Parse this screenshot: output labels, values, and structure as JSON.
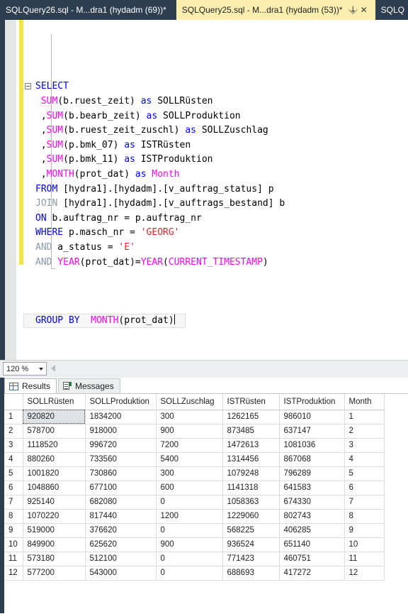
{
  "tabs": [
    {
      "label": "SQLQuery26.sql - M...dra1 (hydadm (69))*",
      "active": false,
      "pin": "",
      "close": ""
    },
    {
      "label": "SQLQuery25.sql - M...dra1 (hydadm (53))*",
      "active": true,
      "pin": "⇲",
      "close": "✕"
    },
    {
      "label": "SQLQ",
      "active": false,
      "pin": "",
      "close": ""
    }
  ],
  "editor": {
    "zoom_level": "120 %",
    "lines": [
      {
        "n": 1,
        "collapse": true,
        "indent": 0,
        "tokens": [
          {
            "t": "SELECT",
            "c": "kw"
          }
        ]
      },
      {
        "n": 2,
        "collapse": false,
        "indent": 1,
        "tokens": [
          {
            "t": "SUM",
            "c": "fn"
          },
          {
            "t": "(b.ruest_zeit)",
            "c": "id"
          },
          {
            "t": " ",
            "c": "id"
          },
          {
            "t": "as",
            "c": "kw"
          },
          {
            "t": " SOLLRüsten",
            "c": "id"
          }
        ]
      },
      {
        "n": 3,
        "collapse": false,
        "indent": 1,
        "tokens": [
          {
            "t": ",",
            "c": "id"
          },
          {
            "t": "SUM",
            "c": "fn"
          },
          {
            "t": "(b.bearb_zeit)",
            "c": "id"
          },
          {
            "t": " ",
            "c": "id"
          },
          {
            "t": "as",
            "c": "kw"
          },
          {
            "t": " SOLLProduktion",
            "c": "id"
          }
        ]
      },
      {
        "n": 4,
        "collapse": false,
        "indent": 1,
        "tokens": [
          {
            "t": ",",
            "c": "id"
          },
          {
            "t": "SUM",
            "c": "fn"
          },
          {
            "t": "(b.ruest_zeit_zuschl)",
            "c": "id"
          },
          {
            "t": " ",
            "c": "id"
          },
          {
            "t": "as",
            "c": "kw"
          },
          {
            "t": " SOLLZuschlag",
            "c": "id"
          }
        ]
      },
      {
        "n": 5,
        "collapse": false,
        "indent": 1,
        "tokens": [
          {
            "t": ",",
            "c": "id"
          },
          {
            "t": "SUM",
            "c": "fn"
          },
          {
            "t": "(p.bmk_07)",
            "c": "id"
          },
          {
            "t": " ",
            "c": "id"
          },
          {
            "t": "as",
            "c": "kw"
          },
          {
            "t": " ISTRüsten",
            "c": "id"
          }
        ]
      },
      {
        "n": 6,
        "collapse": false,
        "indent": 1,
        "tokens": [
          {
            "t": ",",
            "c": "id"
          },
          {
            "t": "SUM",
            "c": "fn"
          },
          {
            "t": "(p.bmk_11)",
            "c": "id"
          },
          {
            "t": " ",
            "c": "id"
          },
          {
            "t": "as",
            "c": "kw"
          },
          {
            "t": " ISTProduktion",
            "c": "id"
          }
        ]
      },
      {
        "n": 7,
        "collapse": false,
        "indent": 1,
        "tokens": [
          {
            "t": ",",
            "c": "id"
          },
          {
            "t": "MONTH",
            "c": "fn"
          },
          {
            "t": "(prot_dat)",
            "c": "id"
          },
          {
            "t": " ",
            "c": "id"
          },
          {
            "t": "as",
            "c": "kw"
          },
          {
            "t": " ",
            "c": "id"
          },
          {
            "t": "Month",
            "c": "fn"
          }
        ]
      },
      {
        "n": 8,
        "collapse": false,
        "indent": 0,
        "tokens": [
          {
            "t": "FROM",
            "c": "kw"
          },
          {
            "t": " [hydra1].[hydadm].[v_auftrag_status] p",
            "c": "id"
          }
        ]
      },
      {
        "n": 9,
        "collapse": false,
        "indent": 0,
        "tokens": [
          {
            "t": "JOIN",
            "c": "kwg"
          },
          {
            "t": " [hydra1].[hydadm].[v_auftrags_bestand] b",
            "c": "id"
          }
        ]
      },
      {
        "n": 10,
        "collapse": false,
        "indent": 0,
        "tokens": [
          {
            "t": "ON",
            "c": "kw"
          },
          {
            "t": " b.auftrag_nr = p.auftrag_nr",
            "c": "id"
          }
        ]
      },
      {
        "n": 11,
        "collapse": false,
        "indent": 0,
        "tokens": [
          {
            "t": "WHERE",
            "c": "kw"
          },
          {
            "t": " p.masch_nr = ",
            "c": "id"
          },
          {
            "t": "'GEORG'",
            "c": "str"
          }
        ]
      },
      {
        "n": 12,
        "collapse": false,
        "indent": 0,
        "tokens": [
          {
            "t": "AND",
            "c": "kwg"
          },
          {
            "t": " a_status = ",
            "c": "id"
          },
          {
            "t": "'E'",
            "c": "str"
          }
        ]
      },
      {
        "n": 13,
        "collapse": false,
        "indent": 0,
        "tokens": [
          {
            "t": "AND",
            "c": "kwg"
          },
          {
            "t": " ",
            "c": "id"
          },
          {
            "t": "YEAR",
            "c": "fn"
          },
          {
            "t": "(prot_dat)=",
            "c": "id"
          },
          {
            "t": "YEAR",
            "c": "fn"
          },
          {
            "t": "(",
            "c": "id"
          },
          {
            "t": "CURRENT_TIMESTAMP",
            "c": "fn"
          },
          {
            "t": ")",
            "c": "id"
          }
        ]
      },
      {
        "n": 14,
        "collapse": false,
        "indent": 0,
        "tokens": []
      },
      {
        "n": 15,
        "collapse": false,
        "indent": 0,
        "tokens": []
      },
      {
        "n": 16,
        "collapse": false,
        "indent": 0,
        "tokens": []
      },
      {
        "n": 17,
        "collapse": false,
        "indent": 0,
        "current": true,
        "tokens": [
          {
            "t": "GROUP",
            "c": "kw"
          },
          {
            "t": " ",
            "c": "id"
          },
          {
            "t": "BY",
            "c": "kw"
          },
          {
            "t": "  ",
            "c": "id"
          },
          {
            "t": "MONTH",
            "c": "fn"
          },
          {
            "t": "(prot_dat)",
            "c": "id"
          }
        ],
        "caret": true
      }
    ]
  },
  "results": {
    "tabs": [
      {
        "label": "Results",
        "icon": "grid-icon",
        "active": true
      },
      {
        "label": "Messages",
        "icon": "message-icon",
        "active": false
      }
    ],
    "columns": [
      "",
      "SOLLRüsten",
      "SOLLProduktion",
      "SOLLZuschlag",
      "ISTRüsten",
      "ISTProduktion",
      "Month"
    ],
    "rows": [
      {
        "n": "1",
        "cells": [
          "920820",
          "1834200",
          "300",
          "1262165",
          "986010",
          "1"
        ],
        "selected_cell": 0
      },
      {
        "n": "2",
        "cells": [
          "578700",
          "918000",
          "900",
          "873485",
          "637147",
          "2"
        ]
      },
      {
        "n": "3",
        "cells": [
          "1118520",
          "996720",
          "7200",
          "1472613",
          "1081036",
          "3"
        ]
      },
      {
        "n": "4",
        "cells": [
          "880260",
          "733560",
          "5400",
          "1314456",
          "867068",
          "4"
        ]
      },
      {
        "n": "5",
        "cells": [
          "1001820",
          "730860",
          "300",
          "1079248",
          "796289",
          "5"
        ]
      },
      {
        "n": "6",
        "cells": [
          "1048860",
          "677100",
          "600",
          "1141318",
          "641583",
          "6"
        ]
      },
      {
        "n": "7",
        "cells": [
          "925140",
          "682080",
          "0",
          "1058363",
          "674330",
          "7"
        ]
      },
      {
        "n": "8",
        "cells": [
          "1070220",
          "817440",
          "1200",
          "1229060",
          "802743",
          "8"
        ]
      },
      {
        "n": "9",
        "cells": [
          "519000",
          "376620",
          "0",
          "568225",
          "406285",
          "9"
        ]
      },
      {
        "n": "10",
        "cells": [
          "849900",
          "625620",
          "900",
          "936524",
          "651140",
          "10"
        ]
      },
      {
        "n": "11",
        "cells": [
          "573180",
          "512100",
          "0",
          "771423",
          "460751",
          "11"
        ]
      },
      {
        "n": "12",
        "cells": [
          "577200",
          "543000",
          "0",
          "688693",
          "417272",
          "12"
        ]
      }
    ]
  },
  "colors": {
    "chrome": "#2d3e50",
    "active_tab": "#fbeeae",
    "change_bar": "#f5e63d",
    "keyword": "#0000ff",
    "function": "#ff00ff",
    "string": "#d42a2a",
    "keyword_dim": "#8a9aa9"
  }
}
